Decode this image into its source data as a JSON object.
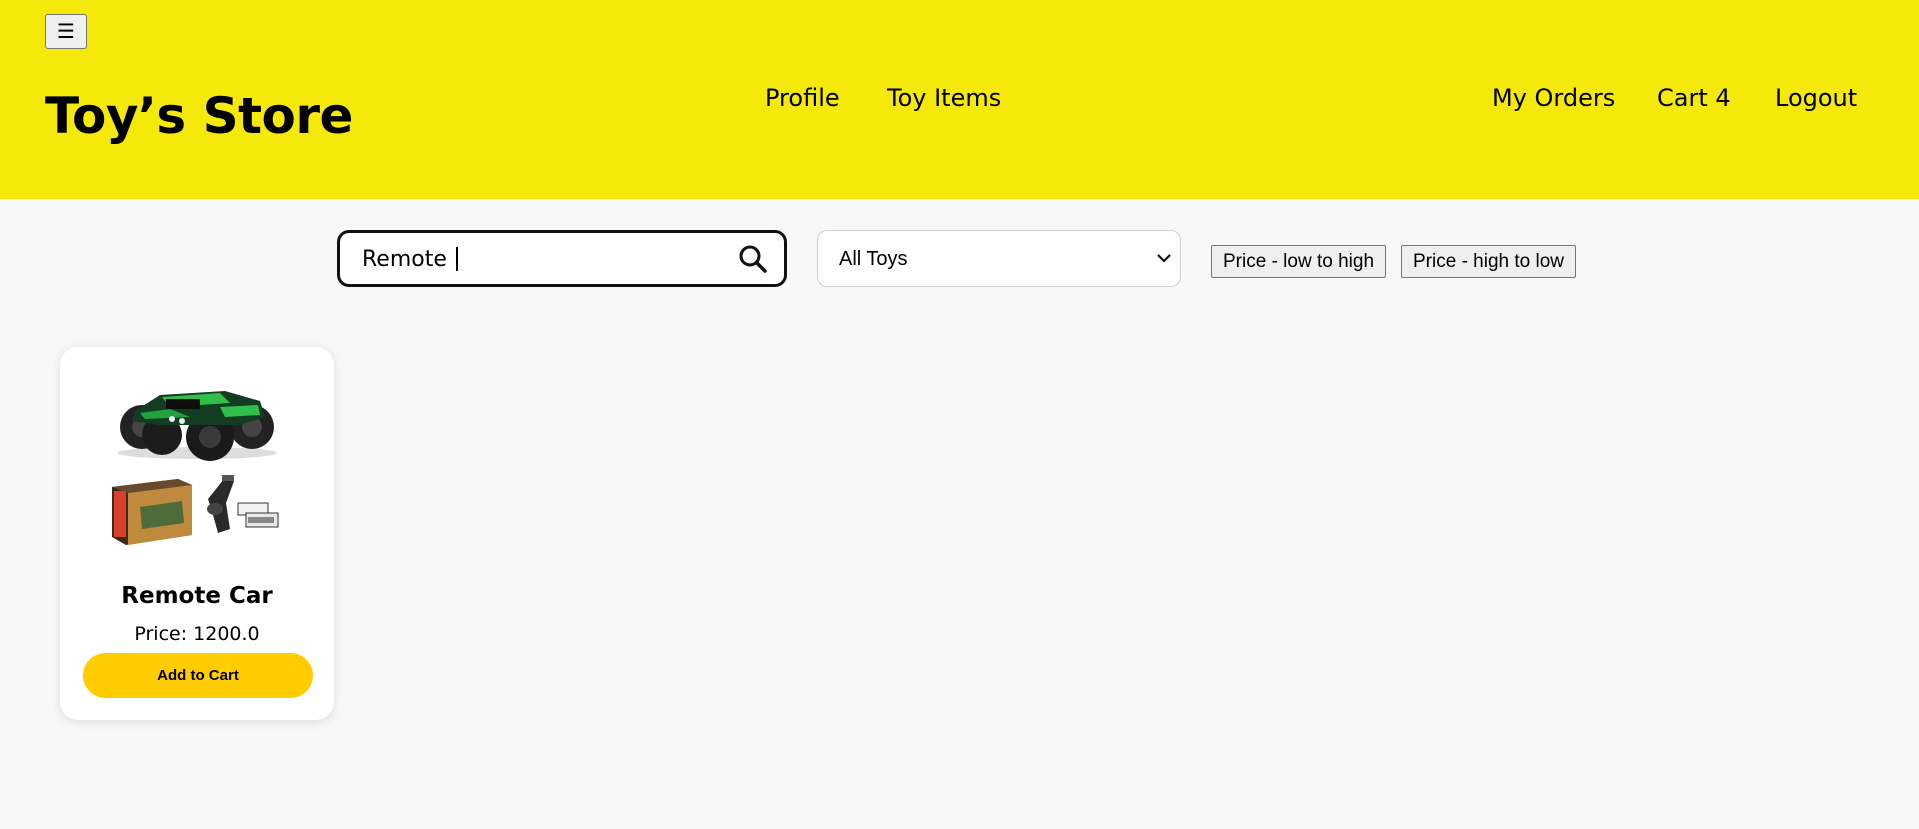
{
  "header": {
    "menu_label": "☰",
    "brand": "Toy’s Store",
    "nav_left": [
      {
        "label": "Profile"
      },
      {
        "label": "Toy Items"
      }
    ],
    "nav_right": [
      {
        "label": "My Orders"
      },
      {
        "label": "Cart 4"
      },
      {
        "label": "Logout"
      }
    ],
    "background_color": "#f5e90c"
  },
  "filters": {
    "search_value": "Remote ",
    "search_icon": "search-icon",
    "category_selected": "All Toys",
    "sort_low_high": "Price - low to high",
    "sort_high_low": "Price - high to low"
  },
  "products": [
    {
      "name": "Remote Car",
      "price": "Price: 1200.0",
      "button": "Add to Cart",
      "image": "remote-car-image",
      "button_color": "#ffcc00"
    }
  ]
}
